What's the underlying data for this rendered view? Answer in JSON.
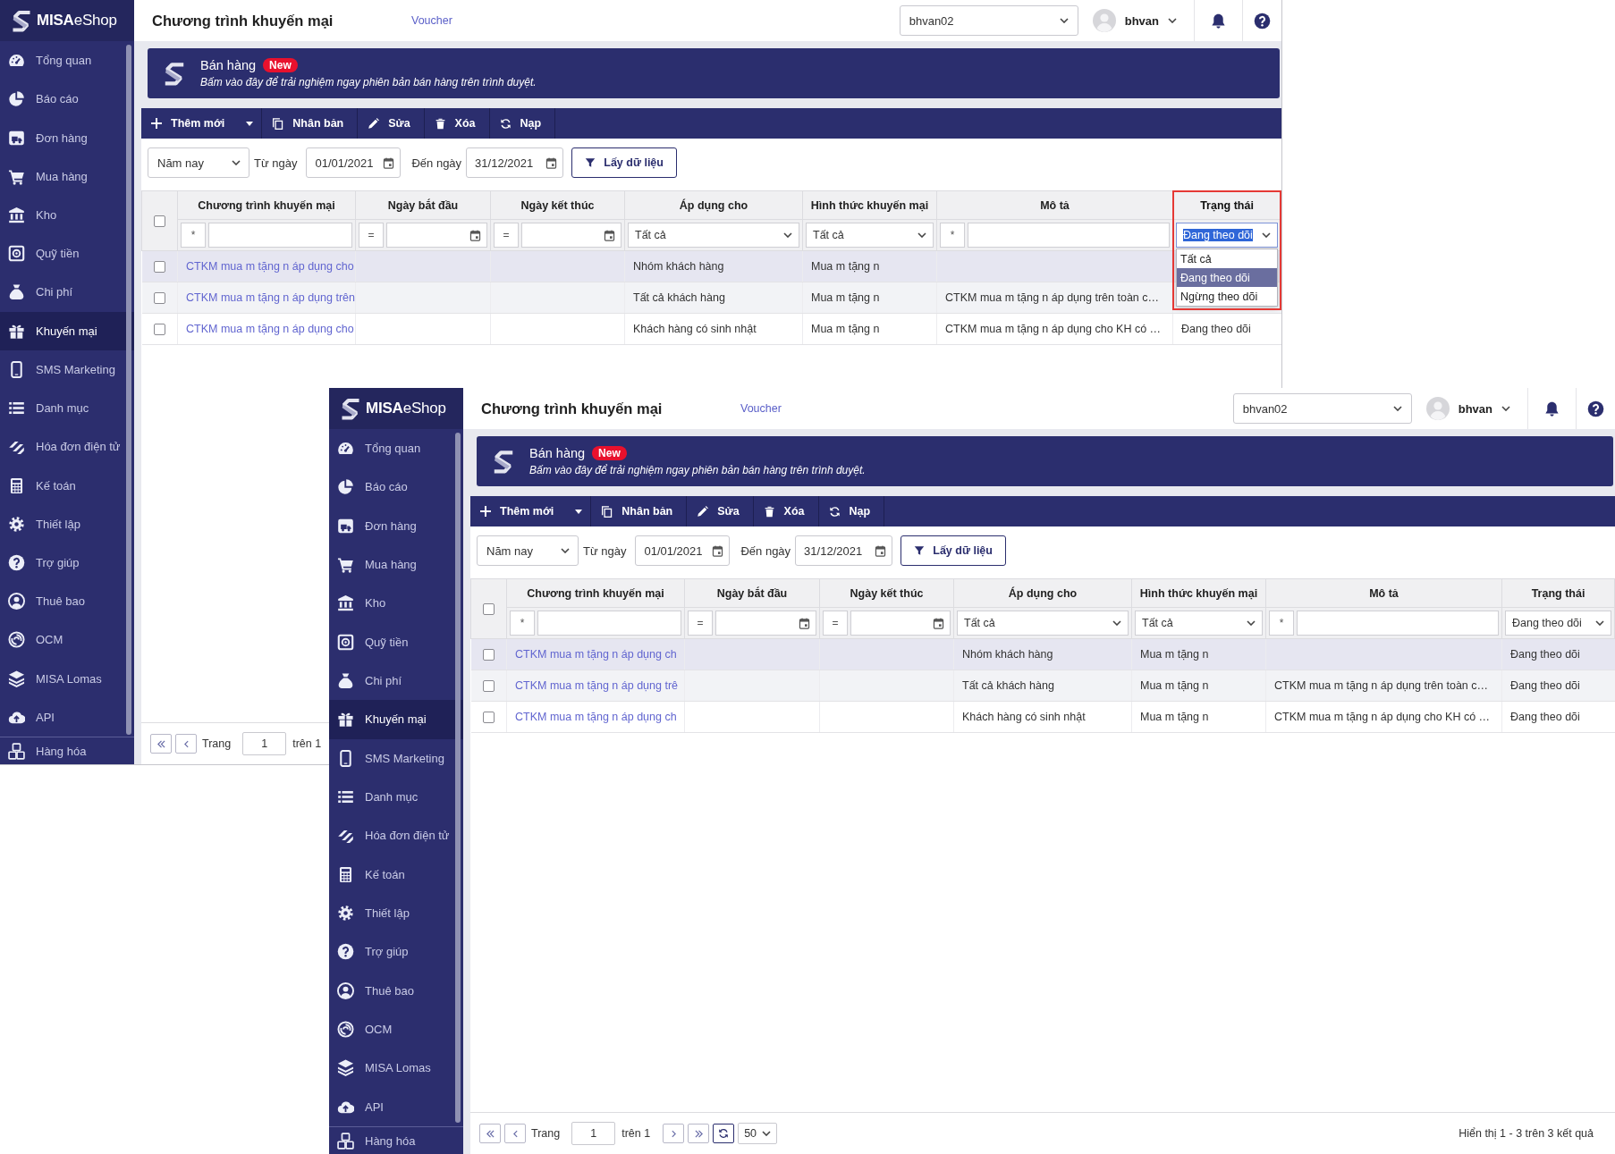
{
  "windows": [
    {
      "sidebar": {
        "logo": "**MISA**eShop",
        "items": [
          {
            "label": "Tổng quan",
            "selected": false
          },
          {
            "label": "Báo cáo",
            "selected": false
          },
          {
            "label": "Đơn hàng",
            "selected": false
          },
          {
            "label": "Mua hàng",
            "selected": false
          },
          {
            "label": "Kho",
            "selected": false
          },
          {
            "label": "Quỹ tiền",
            "selected": false
          },
          {
            "label": "Chi phí",
            "selected": false
          },
          {
            "label": "Khuyến mại",
            "selected": true
          },
          {
            "label": "SMS Marketing",
            "selected": false
          },
          {
            "label": "Danh mục",
            "selected": false
          },
          {
            "label": "Hóa đơn điện tử",
            "selected": false
          },
          {
            "label": "Kế toán",
            "selected": false
          },
          {
            "label": "Thiết lập",
            "selected": false
          },
          {
            "label": "Trợ giúp",
            "selected": false
          },
          {
            "label": "Thuê bao",
            "selected": false
          },
          {
            "label": "OCM",
            "selected": false
          },
          {
            "label": "MISA Lomas",
            "selected": false
          },
          {
            "label": "API",
            "selected": false
          }
        ],
        "footer_item": {
          "label": "Hàng hóa"
        }
      },
      "header": {
        "title": "Chương trình khuyến mại",
        "link": "Voucher",
        "store": "bhvan02",
        "user": "bhvan"
      },
      "banner": {
        "title": "Bán hàng",
        "badge": "New",
        "subtitle": "Bấm vào đây để trải nghiệm ngay phiên bản bán hàng trên trình duyệt."
      },
      "toolbar": [
        {
          "label": "Thêm mới",
          "has_menu": true
        },
        {
          "label": "Nhân bản",
          "has_menu": false
        },
        {
          "label": "Sửa",
          "has_menu": false
        },
        {
          "label": "Xóa",
          "has_menu": false
        },
        {
          "label": "Nạp",
          "has_menu": false
        }
      ],
      "filters": {
        "period": "Năm nay",
        "from_label": "Từ ngày",
        "from_date": "01/01/2021",
        "to_label": "Đến ngày",
        "to_date": "31/12/2021",
        "fetch_button": "Lấy dữ liệu"
      },
      "table": {
        "header_checkbox": {
          "checked": false
        },
        "columns": [
          {
            "label": "Chương trình khuyến mại",
            "highlighted": false,
            "filter": {
              "kind": "text",
              "operator": "*"
            }
          },
          {
            "label": "Ngày bắt đầu",
            "highlighted": false,
            "filter": {
              "kind": "date",
              "operator": "="
            }
          },
          {
            "label": "Ngày kết thúc",
            "highlighted": false,
            "filter": {
              "kind": "date",
              "operator": "="
            }
          },
          {
            "label": "Áp dụng cho",
            "highlighted": false,
            "filter": {
              "kind": "select",
              "value": "Tất cả",
              "focused": false,
              "open": false
            }
          },
          {
            "label": "Hình thức khuyến mại",
            "highlighted": false,
            "filter": {
              "kind": "select",
              "value": "Tất cả",
              "focused": false,
              "open": false
            }
          },
          {
            "label": "Mô tả",
            "highlighted": false,
            "filter": {
              "kind": "text",
              "operator": "*"
            }
          },
          {
            "label": "Trạng thái",
            "highlighted": true,
            "filter": {
              "kind": "select",
              "value": "Đang theo dõi",
              "focused": true,
              "open": true,
              "options": [
                {
                  "label": "Tất cả",
                  "selected": false
                },
                {
                  "label": "Đang theo dõi",
                  "selected": true
                },
                {
                  "label": "Ngừng theo dõi",
                  "selected": false
                }
              ]
            }
          }
        ],
        "rows": [
          {
            "checked": false,
            "selected": true,
            "hovered": false,
            "program": "CTKM mua m tặng n áp dụng cho",
            "applies_to": "Nhóm khách hàng",
            "promotion_type": "Mua m tặng n"
          },
          {
            "checked": false,
            "selected": false,
            "hovered": true,
            "program": "CTKM mua m tặng n áp dụng trên",
            "applies_to": "Tất cả khách hàng",
            "promotion_type": "Mua m tặng n",
            "description": "CTKM mua m tặng n áp dụng trên toàn c…"
          },
          {
            "checked": false,
            "selected": false,
            "hovered": false,
            "program": "CTKM mua m tặng n áp dụng cho",
            "applies_to": "Khách hàng có sinh nhật",
            "promotion_type": "Mua m tặng n",
            "description": "CTKM mua m tặng n áp dụng cho KH có …",
            "status": "Đang theo dõi"
          }
        ]
      },
      "pagination": {
        "nav_before": [
          {
            "kind": "first"
          },
          {
            "kind": "previous"
          }
        ],
        "label": "Trang",
        "page": "1",
        "total": "trên 1"
      }
    },
    {
      "sidebar": {
        "logo": "**MISA**eShop",
        "items": [
          {
            "label": "Tổng quan",
            "selected": false
          },
          {
            "label": "Báo cáo",
            "selected": false
          },
          {
            "label": "Đơn hàng",
            "selected": false
          },
          {
            "label": "Mua hàng",
            "selected": false
          },
          {
            "label": "Kho",
            "selected": false
          },
          {
            "label": "Quỹ tiền",
            "selected": false
          },
          {
            "label": "Chi phí",
            "selected": false
          },
          {
            "label": "Khuyến mại",
            "selected": true
          },
          {
            "label": "SMS Marketing",
            "selected": false
          },
          {
            "label": "Danh mục",
            "selected": false
          },
          {
            "label": "Hóa đơn điện tử",
            "selected": false
          },
          {
            "label": "Kế toán",
            "selected": false
          },
          {
            "label": "Thiết lập",
            "selected": false
          },
          {
            "label": "Trợ giúp",
            "selected": false
          },
          {
            "label": "Thuê bao",
            "selected": false
          },
          {
            "label": "OCM",
            "selected": false
          },
          {
            "label": "MISA Lomas",
            "selected": false
          },
          {
            "label": "API",
            "selected": false
          }
        ],
        "footer_item": {
          "label": "Hàng hóa"
        }
      },
      "header": {
        "title": "Chương trình khuyến mại",
        "link": "Voucher",
        "store": "bhvan02",
        "user": "bhvan"
      },
      "banner": {
        "title": "Bán hàng",
        "badge": "New",
        "subtitle": "Bấm vào đây để trải nghiệm ngay phiên bản bán hàng trên trình duyệt."
      },
      "toolbar": [
        {
          "label": "Thêm mới",
          "has_menu": true
        },
        {
          "label": "Nhân bản",
          "has_menu": false
        },
        {
          "label": "Sửa",
          "has_menu": false
        },
        {
          "label": "Xóa",
          "has_menu": false
        },
        {
          "label": "Nạp",
          "has_menu": false
        }
      ],
      "filters": {
        "period": "Năm nay",
        "from_label": "Từ ngày",
        "from_date": "01/01/2021",
        "to_label": "Đến ngày",
        "to_date": "31/12/2021",
        "fetch_button": "Lấy dữ liệu"
      },
      "table": {
        "header_checkbox": {
          "checked": false
        },
        "columns": [
          {
            "label": "Chương trình khuyến mại",
            "highlighted": false,
            "filter": {
              "kind": "text",
              "operator": "*"
            }
          },
          {
            "label": "Ngày bắt đầu",
            "highlighted": false,
            "filter": {
              "kind": "date",
              "operator": "="
            }
          },
          {
            "label": "Ngày kết thúc",
            "highlighted": false,
            "filter": {
              "kind": "date",
              "operator": "="
            }
          },
          {
            "label": "Áp dụng cho",
            "highlighted": false,
            "filter": {
              "kind": "select",
              "value": "Tất cả",
              "focused": false,
              "open": false
            }
          },
          {
            "label": "Hình thức khuyến mại",
            "highlighted": false,
            "filter": {
              "kind": "select",
              "value": "Tất cả",
              "focused": false,
              "open": false
            }
          },
          {
            "label": "Mô tả",
            "highlighted": false,
            "filter": {
              "kind": "text",
              "operator": "*"
            }
          },
          {
            "label": "Trạng thái",
            "highlighted": false,
            "filter": {
              "kind": "select",
              "value": "Đang theo dõi",
              "focused": false,
              "open": false
            }
          }
        ],
        "rows": [
          {
            "checked": false,
            "selected": true,
            "hovered": false,
            "program": "CTKM mua m tặng n áp dụng ch",
            "applies_to": "Nhóm khách hàng",
            "promotion_type": "Mua m tặng n",
            "status": "Đang theo dõi"
          },
          {
            "checked": false,
            "selected": false,
            "hovered": true,
            "program": "CTKM mua m tặng n áp dụng trê",
            "applies_to": "Tất cả khách hàng",
            "promotion_type": "Mua m tặng n",
            "description": "CTKM mua m tặng n áp dụng trên toàn c…",
            "status": "Đang theo dõi"
          },
          {
            "checked": false,
            "selected": false,
            "hovered": false,
            "program": "CTKM mua m tặng n áp dụng ch",
            "applies_to": "Khách hàng có sinh nhật",
            "promotion_type": "Mua m tặng n",
            "description": "CTKM mua m tặng n áp dụng cho KH có …",
            "status": "Đang theo dõi"
          }
        ]
      },
      "pagination": {
        "nav_before": [
          {
            "kind": "first"
          },
          {
            "kind": "previous"
          }
        ],
        "label": "Trang",
        "page": "1",
        "total": "trên 1",
        "nav_after": [
          {
            "kind": "next"
          },
          {
            "kind": "last"
          },
          {
            "kind": "reload"
          }
        ],
        "page_size": "50",
        "summary": "Hiển thị 1 - 3 trên 3 kết quả"
      }
    }
  ]
}
